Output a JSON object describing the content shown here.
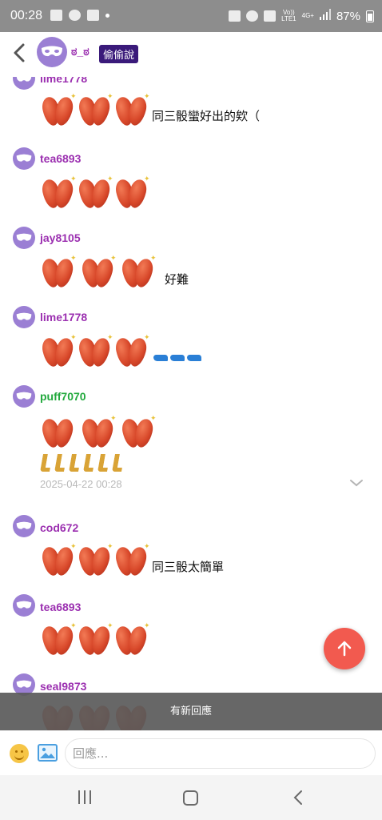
{
  "status_bar": {
    "time": "00:28",
    "battery": "87%",
    "network": "4G+"
  },
  "header": {
    "back_icon": "chevron-left-icon",
    "name": "ಠ_ಠ",
    "badge": "偷偷說"
  },
  "messages": [
    {
      "user": "lime1778",
      "text": "同三骰蠻好出的欸（",
      "stickers": 3
    },
    {
      "user": "tea6893",
      "text": "",
      "stickers": 3
    },
    {
      "user": "jay8105",
      "text": "好難",
      "stickers": 3
    },
    {
      "user": "lime1778",
      "text": "",
      "stickers": 3,
      "extra": "blue-heels"
    },
    {
      "user": "puff7070",
      "text": "",
      "stickers": 3,
      "extra": "golden-legs",
      "timestamp": "2025-04-22 00:28"
    },
    {
      "user": "cod672",
      "text": "同三骰太簡單",
      "stickers": 3
    },
    {
      "user": "tea6893",
      "text": "",
      "stickers": 3
    },
    {
      "user": "seal9873",
      "text": "",
      "stickers": 3
    }
  ],
  "new_reply_banner": "有新回應",
  "input": {
    "placeholder": "回應..."
  },
  "colors": {
    "username": "#9b2fb0",
    "username_green": "#22a93d",
    "fab": "#f25a4f",
    "avatar": "#9b7fd4",
    "badge": "#3a1a7a"
  }
}
